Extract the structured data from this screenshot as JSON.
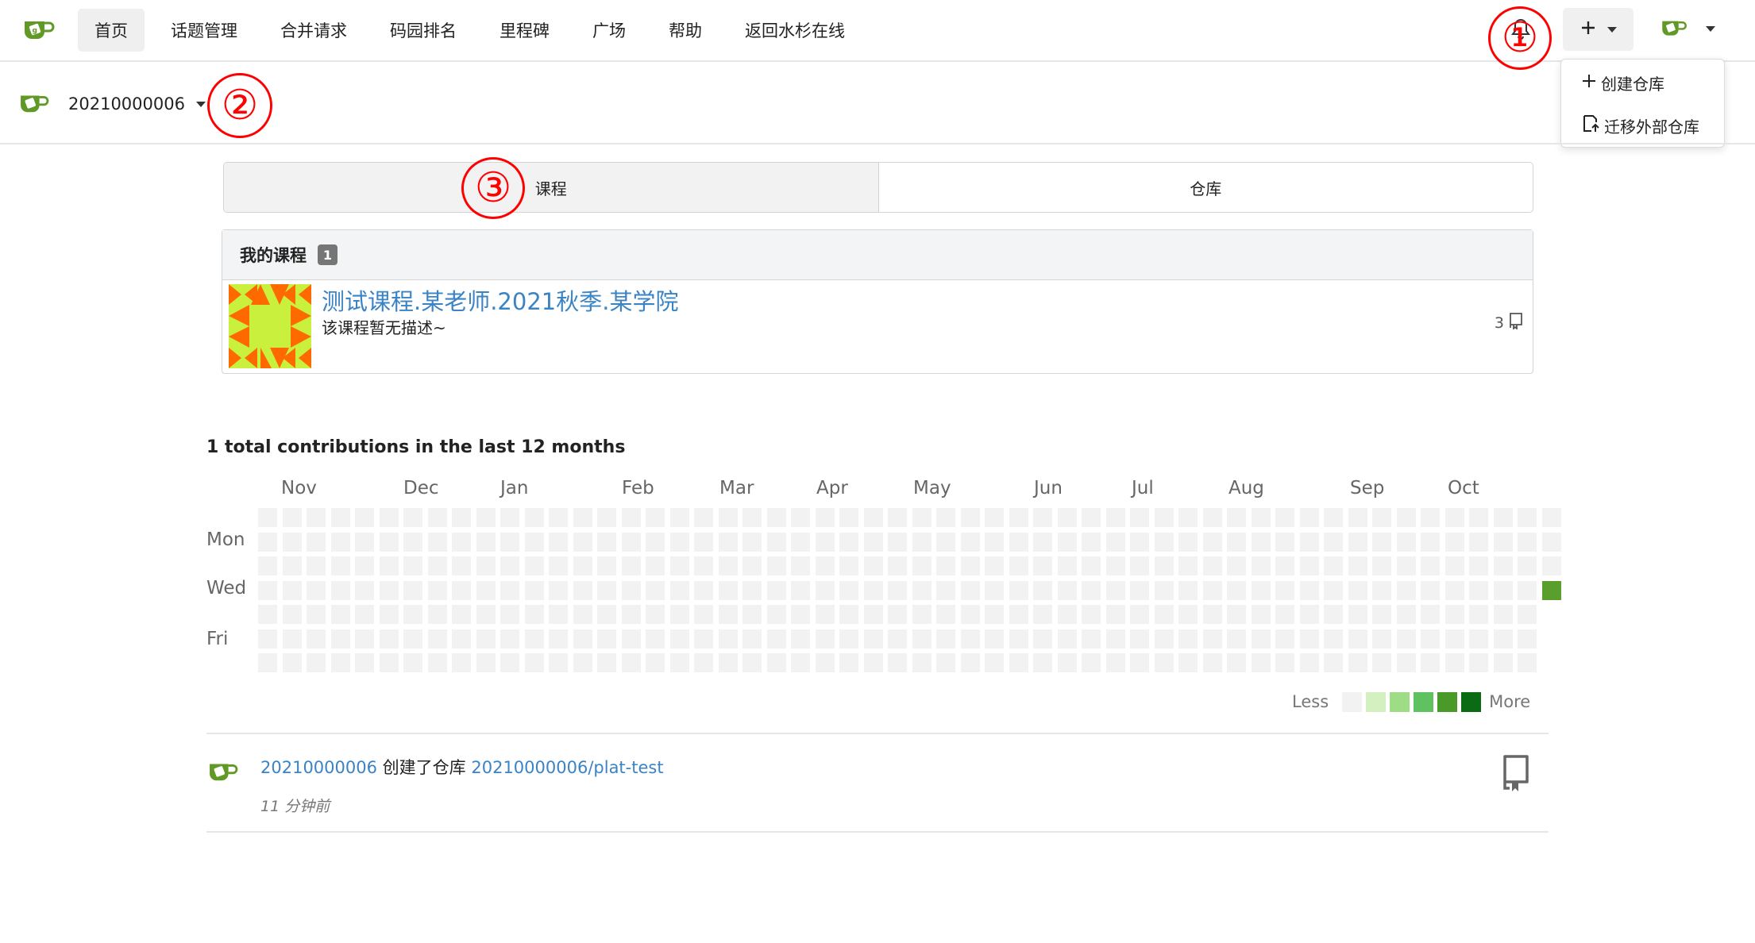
{
  "nav": {
    "items": [
      "首页",
      "话题管理",
      "合并请求",
      "码园排名",
      "里程碑",
      "广场",
      "帮助",
      "返回水杉在线"
    ],
    "active_index": 0
  },
  "create_menu": {
    "items": [
      {
        "label": "创建仓库",
        "icon": "plus-icon"
      },
      {
        "label": "迁移外部仓库",
        "icon": "migrate-icon"
      }
    ]
  },
  "context": {
    "name": "20210000006"
  },
  "annotations": [
    "①",
    "②",
    "③"
  ],
  "tabs": {
    "items": [
      "课程",
      "仓库"
    ],
    "active_index": 0
  },
  "courses": {
    "header": "我的课程",
    "count": "1",
    "items": [
      {
        "name": "测试课程.某老师.2021秋季.某学院",
        "description": "该课程暂无描述~",
        "repo_count": "3"
      }
    ]
  },
  "contributions": {
    "title": "1 total contributions in the last 12 months",
    "months": [
      "Nov",
      "Dec",
      "Jan",
      "Feb",
      "Mar",
      "Apr",
      "May",
      "Jun",
      "Jul",
      "Aug",
      "Sep",
      "Oct"
    ],
    "days": [
      "Mon",
      "Wed",
      "Fri"
    ],
    "legend_less": "Less",
    "legend_more": "More",
    "legend_colors": [
      "#eeeeee",
      "#d6e685",
      "#8cc665",
      "#5fc15f",
      "#44a340",
      "#1e6823"
    ],
    "colors_display": [
      "#f2f2f2",
      "#d4efc0",
      "#9edc86",
      "#5fc15f",
      "#4a9a2a",
      "#0b6b14"
    ],
    "active_color": "#5a9f2d",
    "active_cell": {
      "week": 53,
      "day": 3,
      "count": 1
    }
  },
  "feed": {
    "items": [
      {
        "user": "20210000006",
        "action": "创建了仓库",
        "repo": "20210000006/plat-test",
        "time": "11 分钟前"
      }
    ]
  },
  "brand_color": "#609926",
  "link_color": "#3a83c5"
}
